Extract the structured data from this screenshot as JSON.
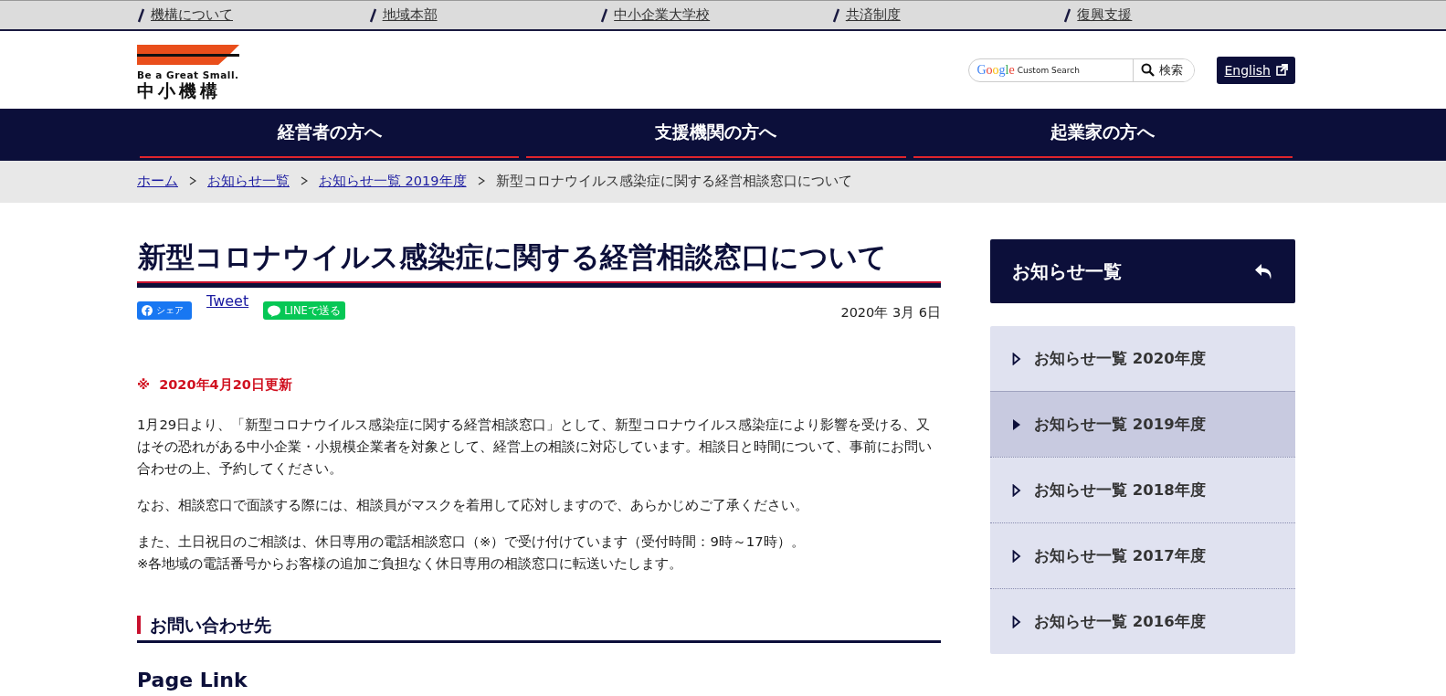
{
  "top_links": [
    "機構について",
    "地域本部",
    "中小企業大学校",
    "共済制度",
    "復興支援"
  ],
  "logo": {
    "tagline": "Be a Great Small.",
    "name": "中小機構"
  },
  "search": {
    "brand": "Google",
    "placeholder": "Custom Search",
    "button": "検索"
  },
  "english_link": "English",
  "main_nav": [
    "経営者の方へ",
    "支援機関の方へ",
    "起業家の方へ"
  ],
  "breadcrumb": [
    {
      "label": "ホーム",
      "link": true
    },
    {
      "label": "お知らせ一覧",
      "link": true
    },
    {
      "label": "お知らせ一覧 2019年度",
      "link": true
    },
    {
      "label": "新型コロナウイルス感染症に関する経営相談窓口について",
      "link": false
    }
  ],
  "article": {
    "title": "新型コロナウイルス感染症に関する経営相談窓口について",
    "share": {
      "facebook": "シェア",
      "tweet": "Tweet",
      "line": "LINEで送る"
    },
    "date": "2020年 3月 6日",
    "update_note": "※  2020年4月20日更新",
    "paragraphs": [
      {
        "lines": [
          "1月29日より、「新型コロナウイルス感染症に関する経営相談窓口」として、新型コロナウイルス感染症により影響を受ける、又はその恐れがある中小企業・小規模企業者を対象として、経営上の相談に対応しています。相談日と時間について、事前にお問い合わせの上、予約してください。"
        ]
      },
      {
        "lines": [
          "なお、相談窓口で面談する際には、相談員がマスクを着用して応対しますので、あらかじめご了承ください。"
        ]
      },
      {
        "lines": [
          "また、土日祝日のご相談は、休日専用の電話相談窓口（※）で受け付けています（受付時間：9時～17時）。",
          "※各地域の電話番号からお客様の追加ご負担なく休日専用の相談窓口に転送いたします。"
        ]
      }
    ],
    "section_heading": "お問い合わせ先",
    "next_heading": "Page Link"
  },
  "sidebar": {
    "title": "お知らせ一覧",
    "items": [
      {
        "label": "お知らせ一覧 2020年度",
        "selected": false
      },
      {
        "label": "お知らせ一覧 2019年度",
        "selected": true
      },
      {
        "label": "お知らせ一覧 2018年度",
        "selected": false
      },
      {
        "label": "お知らせ一覧 2017年度",
        "selected": false
      },
      {
        "label": "お知らせ一覧 2016年度",
        "selected": false
      }
    ]
  }
}
